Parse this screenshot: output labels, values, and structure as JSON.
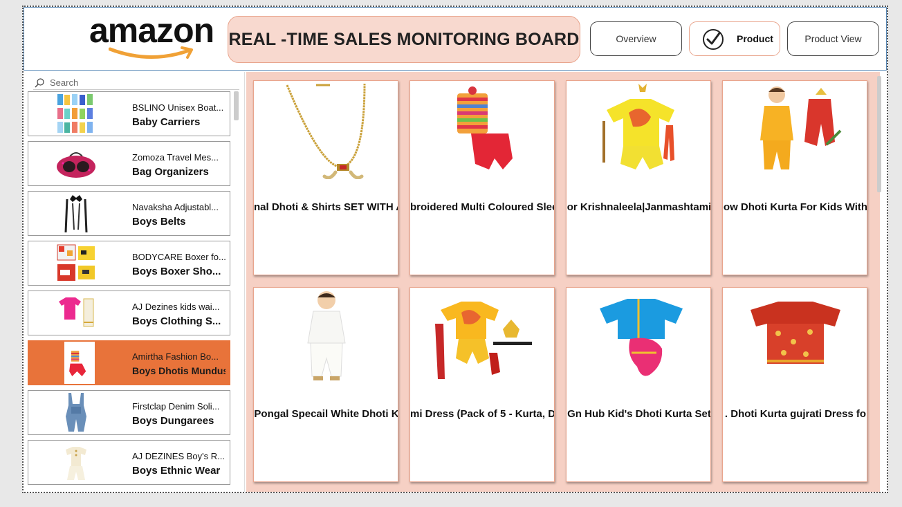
{
  "header": {
    "logo_text": "amazon",
    "title": "REAL -TIME SALES MONITORING BOARD",
    "nav": {
      "overview": "Overview",
      "product": "Product",
      "product_view": "Product View"
    }
  },
  "sidebar": {
    "search_placeholder": "Search",
    "items": [
      {
        "product": "BSLINO Unisex Boat...",
        "category": "Baby Carriers"
      },
      {
        "product": "Zomoza Travel Mes...",
        "category": "Bag Organizers"
      },
      {
        "product": "Navaksha Adjustabl...",
        "category": "Boys Belts"
      },
      {
        "product": "BODYCARE Boxer fo...",
        "category": "Boys Boxer Sho..."
      },
      {
        "product": "AJ Dezines kids wai...",
        "category": "Boys Clothing S..."
      },
      {
        "product": "Amirtha Fashion Bo...",
        "category": "Boys Dhotis Mundus",
        "selected": true
      },
      {
        "product": "Firstclap Denim Soli...",
        "category": "Boys Dungarees"
      },
      {
        "product": "AJ DEZINES Boy's R...",
        "category": "Boys Ethnic Wear"
      }
    ]
  },
  "products": [
    {
      "name": "nal Dhoti & Shirts SET WITH A"
    },
    {
      "name": "broidered Multi Coloured Slee"
    },
    {
      "name": "or Krishnaleela|Janmashtami"
    },
    {
      "name": "ow Dhoti Kurta For Kids With"
    },
    {
      "name": "Pongal Specail White Dhoti K"
    },
    {
      "name": "mi Dress (Pack of 5 - Kurta, D"
    },
    {
      "name": "Gn Hub Kid's Dhoti Kurta Set"
    },
    {
      "name": ". Dhoti Kurta gujrati Dress fo"
    }
  ],
  "colors": {
    "accent": "#e8733a",
    "title_bg": "#f8d9cf",
    "panel_bg": "#f6d0c4",
    "logo_smile": "#f0a136"
  }
}
